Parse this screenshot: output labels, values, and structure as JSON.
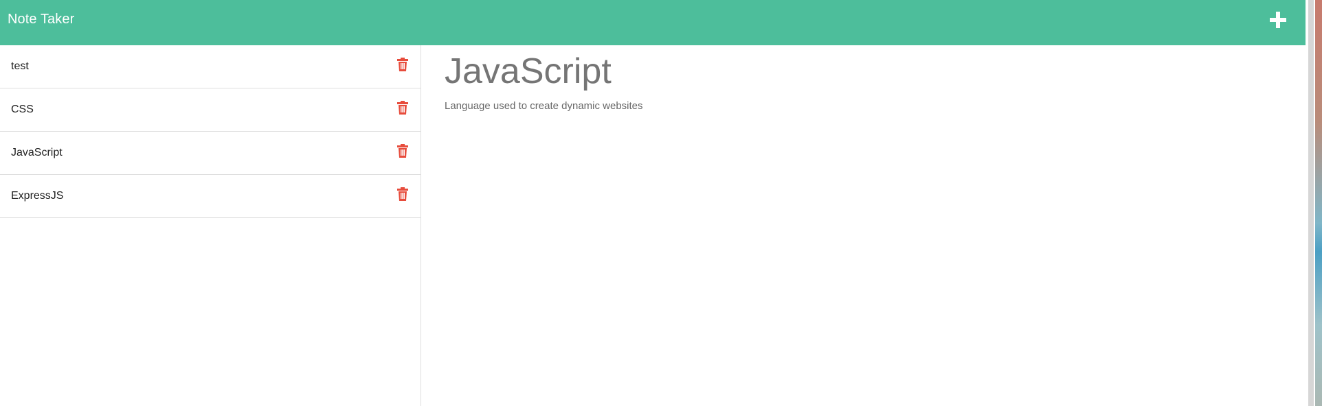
{
  "header": {
    "title": "Note Taker",
    "new_note_icon": "plus-icon"
  },
  "sidebar": {
    "notes": [
      {
        "title": "test",
        "delete_icon": "trash-icon"
      },
      {
        "title": "CSS",
        "delete_icon": "trash-icon"
      },
      {
        "title": "JavaScript",
        "delete_icon": "trash-icon"
      },
      {
        "title": "ExpressJS",
        "delete_icon": "trash-icon"
      }
    ]
  },
  "main": {
    "note_title": "JavaScript",
    "note_text": "Language used to create dynamic websites"
  },
  "colors": {
    "navbar": "#4dbe9b",
    "delete": "#e74c3c",
    "heading": "#757575"
  }
}
